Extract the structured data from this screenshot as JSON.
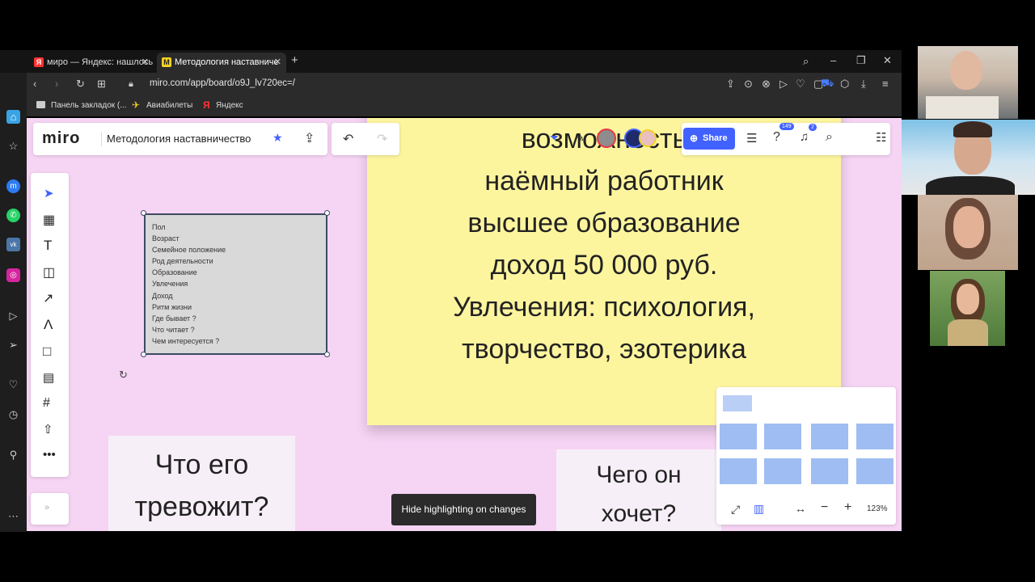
{
  "browser": {
    "tabs": [
      {
        "favicon": "Я",
        "title": "миро — Яндекс: нашлось"
      },
      {
        "favicon": "M",
        "title": "Методология наставниче"
      }
    ],
    "new_tab": "+",
    "url": "miro.com/app/board/o9J_lv720ec=/",
    "bookmarks": [
      {
        "icon": "folder-icon",
        "label": "Панель закладок (..."
      },
      {
        "icon": "plane-icon",
        "label": "Авиабилеты"
      },
      {
        "icon": "yandex-icon",
        "label": "Яндекс"
      }
    ]
  },
  "miro": {
    "logo": "miro",
    "board_title": "Методология наставничество",
    "share_label": "Share",
    "notifications_badge": "149",
    "bell_badge": "2",
    "zoom": "123%",
    "toast": "Hide highlighting on changes"
  },
  "board": {
    "sticky_lines": [
      "возможность",
      "наёмный работник",
      "высшее образование",
      "доход 50 000 руб.",
      "Увлечения: психология,",
      "творчество, эзотерика"
    ],
    "list_items": [
      "Пол",
      "Возраст",
      "Семейное положение",
      "Род деятельности",
      "Образование",
      "Увлечения",
      "Доход",
      "Ритм жизни",
      "Где бывает ?",
      "Что читает ?",
      "Чем интересуется ?"
    ],
    "card_left": [
      "Что его",
      "тревожит?"
    ],
    "card_right": [
      "Чего он",
      "хочет?"
    ]
  },
  "colors": {
    "canvas": "#f6d4f4",
    "sticky": "#fdf59e",
    "share": "#4262ff",
    "opera_red": "#e0182d"
  }
}
